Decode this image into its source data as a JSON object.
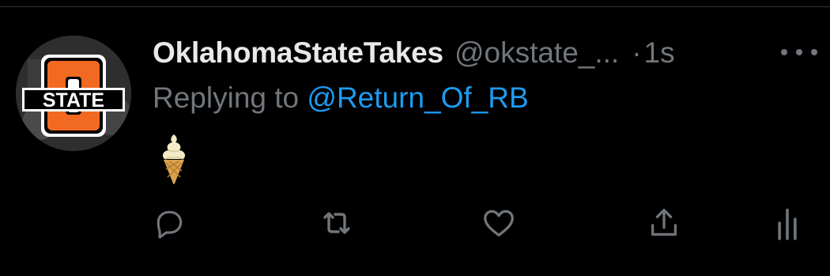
{
  "tweet": {
    "display_name": "OklahomaStateTakes",
    "handle": "@okstate_...",
    "separator": "·",
    "timestamp": "1s",
    "reply_prefix": "Replying to ",
    "reply_to": "@Return_Of_RB",
    "body_emoji": "🍦"
  },
  "avatar": {
    "logo_text": "STATE",
    "brand_color": "#f26a21"
  },
  "colors": {
    "background": "#000000",
    "primary_text": "#e7e9ea",
    "secondary_text": "#71767b",
    "accent": "#1d9bf0"
  },
  "actions": [
    {
      "name": "reply",
      "icon": "speech-bubble-icon"
    },
    {
      "name": "retweet",
      "icon": "retweet-arrows-icon"
    },
    {
      "name": "like",
      "icon": "heart-outline-icon"
    },
    {
      "name": "share",
      "icon": "share-upload-icon"
    },
    {
      "name": "analytics",
      "icon": "bar-chart-icon"
    }
  ]
}
